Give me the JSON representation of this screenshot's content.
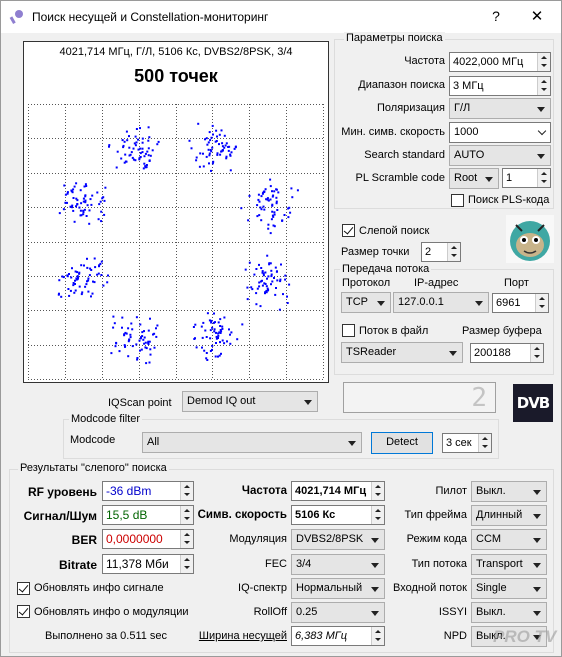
{
  "window": {
    "title": "Поиск несущей и Constellation-мониторинг",
    "help": "?",
    "close": "✕"
  },
  "constellation": {
    "info": "4021,714 МГц, Г/Л, 5106 Кс, DVBS2/8PSK, 3/4",
    "points_label": "500 точек"
  },
  "search_params": {
    "legend": "Параметры поиска",
    "frequency_label": "Частота",
    "frequency": "4022,000 МГц",
    "range_label": "Диапазон поиска",
    "range": "3 МГц",
    "polarization_label": "Поляризация",
    "polarization": "Г/Л",
    "min_sr_label": "Мин. симв. скорость",
    "min_sr": "1000",
    "standard_label": "Search standard",
    "standard": "AUTO",
    "pls_label": "PL Scramble code",
    "pls_mode": "Root",
    "pls_value": "1",
    "pls_search_label": "Поиск PLS-кода",
    "pls_search_checked": false
  },
  "blind": {
    "label": "Слепой поиск",
    "checked": true,
    "point_size_label": "Размер точки",
    "point_size": "2"
  },
  "stream": {
    "legend": "Передача потока",
    "protocol_label": "Протокол",
    "protocol": "TCP",
    "ip_label": "IP-адрес",
    "ip": "127.0.0.1",
    "port_label": "Порт",
    "port": "6961",
    "to_file_label": "Поток в файл",
    "to_file_checked": false,
    "buffer_label": "Размер буфера",
    "buffer": "200188",
    "reader": "TSReader"
  },
  "display_value": "2",
  "dvb_logo": "DVB",
  "iqscan": {
    "label": "IQScan point",
    "value": "Demod IQ out"
  },
  "modcode": {
    "legend": "Modcode filter",
    "label": "Modcode",
    "value": "All",
    "detect": "Detect",
    "interval": "3 сек"
  },
  "results": {
    "legend": "Результаты \"слепого\" поиска",
    "rf_label": "RF уровень",
    "rf": "-36 dBm",
    "snr_label": "Сигнал/Шум",
    "snr": "15,5 dB",
    "ber_label": "BER",
    "ber": "0,0000000",
    "bitrate_label": "Bitrate",
    "bitrate": "11,378 Мби",
    "upd_signal_label": "Обновлять инфо сигнале",
    "upd_signal": true,
    "upd_mod_label": "Обновлять инфо о модуляции",
    "upd_mod": true,
    "done_label": "Выполнено за 0.511 sec",
    "freq_label": "Частота",
    "freq": "4021,714 МГц",
    "sr_label": "Симв. скорость",
    "sr": "5106 Кс",
    "mod_label": "Модуляция",
    "mod": "DVBS2/8PSK",
    "fec_label": "FEC",
    "fec": "3/4",
    "iq_label": "IQ-спектр",
    "iq": "Нормальный",
    "rolloff_label": "RollOff",
    "rolloff": "0.25",
    "bw_label": "Ширина несущей",
    "bw": "6,383 МГц",
    "pilot_label": "Пилот",
    "pilot": "Выкл.",
    "frame_label": "Тип фрейма",
    "frame": "Длинный",
    "ccm_label": "Режим кода",
    "ccm": "CCM",
    "stream_type_label": "Тип потока",
    "stream_type": "Transport",
    "input_label": "Входной поток",
    "input": "Single",
    "issyi_label": "ISSYI",
    "issyi": "Выкл.",
    "npd_label": "NPD",
    "npd": "Выкл."
  },
  "watermark": "PRO TV",
  "colors": {
    "points": "#0000ff",
    "rf": "#0000cc",
    "snr": "#006400",
    "ber": "#cc0000",
    "accent": "#0078d7"
  }
}
